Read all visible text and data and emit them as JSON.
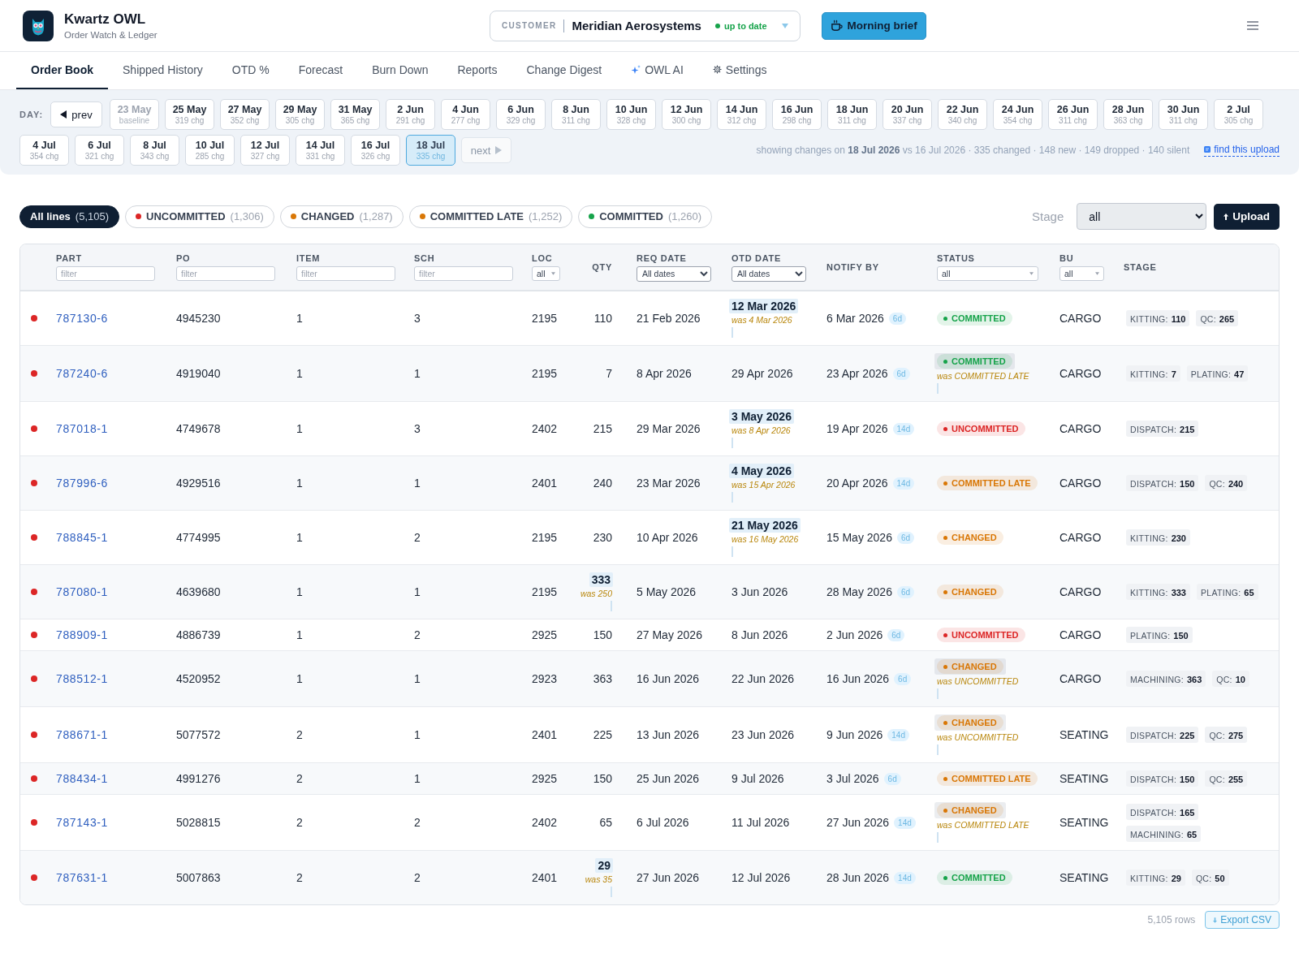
{
  "app": {
    "name": "Kwartz OWL",
    "tagline": "Order Watch & Ledger"
  },
  "customer": {
    "label": "CUSTOMER",
    "name": "Meridian Aerosystems",
    "sync": "up to date"
  },
  "brief_button": "Morning brief",
  "tabs": [
    {
      "label": "Order Book",
      "selected": true,
      "kind": "page"
    },
    {
      "label": "Shipped History",
      "selected": false,
      "kind": "page"
    },
    {
      "label": "OTD %",
      "selected": false,
      "kind": "page"
    },
    {
      "label": "Forecast",
      "selected": false,
      "kind": "page"
    },
    {
      "label": "Burn Down",
      "selected": false,
      "kind": "page"
    },
    {
      "label": "Reports",
      "selected": false,
      "kind": "page"
    },
    {
      "label": "Change Digest",
      "selected": false,
      "kind": "page"
    },
    {
      "label": "OWL AI",
      "selected": false,
      "kind": "assistant"
    },
    {
      "label": "Settings",
      "selected": false,
      "kind": "settings"
    }
  ],
  "day_picker": {
    "label": "DAY:",
    "prev": {
      "label": "prev",
      "disabled": false
    },
    "days": [
      {
        "date": "23 May",
        "note": "baseline",
        "selected": false,
        "disabled": true
      },
      {
        "date": "25 May",
        "note": "319 chg",
        "selected": false,
        "disabled": false
      },
      {
        "date": "27 May",
        "note": "352 chg",
        "selected": false,
        "disabled": false
      },
      {
        "date": "29 May",
        "note": "305 chg",
        "selected": false,
        "disabled": false
      },
      {
        "date": "31 May",
        "note": "365 chg",
        "selected": false,
        "disabled": false
      },
      {
        "date": "2 Jun",
        "note": "291 chg",
        "selected": false,
        "disabled": false
      },
      {
        "date": "4 Jun",
        "note": "277 chg",
        "selected": false,
        "disabled": false
      },
      {
        "date": "6 Jun",
        "note": "329 chg",
        "selected": false,
        "disabled": false
      },
      {
        "date": "8 Jun",
        "note": "311 chg",
        "selected": false,
        "disabled": false
      },
      {
        "date": "10 Jun",
        "note": "328 chg",
        "selected": false,
        "disabled": false
      },
      {
        "date": "12 Jun",
        "note": "300 chg",
        "selected": false,
        "disabled": false
      },
      {
        "date": "14 Jun",
        "note": "312 chg",
        "selected": false,
        "disabled": false
      },
      {
        "date": "16 Jun",
        "note": "298 chg",
        "selected": false,
        "disabled": false
      },
      {
        "date": "18 Jun",
        "note": "311 chg",
        "selected": false,
        "disabled": false
      },
      {
        "date": "20 Jun",
        "note": "337 chg",
        "selected": false,
        "disabled": false
      },
      {
        "date": "22 Jun",
        "note": "340 chg",
        "selected": false,
        "disabled": false
      },
      {
        "date": "24 Jun",
        "note": "354 chg",
        "selected": false,
        "disabled": false
      },
      {
        "date": "26 Jun",
        "note": "311 chg",
        "selected": false,
        "disabled": false
      },
      {
        "date": "28 Jun",
        "note": "363 chg",
        "selected": false,
        "disabled": false
      },
      {
        "date": "30 Jun",
        "note": "311 chg",
        "selected": false,
        "disabled": false
      },
      {
        "date": "2 Jul",
        "note": "305 chg",
        "selected": false,
        "disabled": false
      },
      {
        "date": "4 Jul",
        "note": "354 chg",
        "selected": false,
        "disabled": false
      },
      {
        "date": "6 Jul",
        "note": "321 chg",
        "selected": false,
        "disabled": false
      },
      {
        "date": "8 Jul",
        "note": "343 chg",
        "selected": false,
        "disabled": false
      },
      {
        "date": "10 Jul",
        "note": "285 chg",
        "selected": false,
        "disabled": false
      },
      {
        "date": "12 Jul",
        "note": "327 chg",
        "selected": false,
        "disabled": false
      },
      {
        "date": "14 Jul",
        "note": "331 chg",
        "selected": false,
        "disabled": false
      },
      {
        "date": "16 Jul",
        "note": "326 chg",
        "selected": false,
        "disabled": false
      },
      {
        "date": "18 Jul",
        "note": "335 chg",
        "selected": true,
        "disabled": false
      }
    ],
    "next": {
      "label": "next",
      "disabled": true
    },
    "summary": "showing changes on **18 Jul 2026** vs 16 Jul 2026 · 335 changed · 148 new · 149 dropped · 140 silent",
    "link": "find this upload"
  },
  "line_filters": [
    {
      "label": "All lines",
      "count": "(5,105)",
      "selected": true
    },
    {
      "label": "UNCOMMITTED",
      "count": "(1,306)",
      "selected": false,
      "color": "#dc2626"
    },
    {
      "label": "CHANGED",
      "count": "(1,287)",
      "selected": false,
      "color": "#d97706"
    },
    {
      "label": "COMMITTED LATE",
      "count": "(1,252)",
      "selected": false,
      "color": "#d97706"
    },
    {
      "label": "COMMITTED",
      "count": "(1,260)",
      "selected": false,
      "color": "#16a34a"
    }
  ],
  "stage_filter": {
    "label": "Stage",
    "value": "all"
  },
  "upload_button": "Upload",
  "table": {
    "columns": [
      {
        "label": "PART",
        "filter": {
          "kind": "input",
          "placeholder": "filter"
        }
      },
      {
        "label": "PO",
        "filter": {
          "kind": "input",
          "placeholder": "filter"
        }
      },
      {
        "label": "ITEM",
        "filter": {
          "kind": "input",
          "placeholder": "filter"
        }
      },
      {
        "label": "SCH",
        "filter": {
          "kind": "input",
          "placeholder": "filter"
        }
      },
      {
        "label": "LOC",
        "filter": {
          "kind": "picker",
          "value": "all"
        }
      },
      {
        "label": "QTY"
      },
      {
        "label": "REQ DATE",
        "filter": {
          "kind": "select",
          "value": "All dates"
        }
      },
      {
        "label": "OTD DATE",
        "filter": {
          "kind": "select",
          "value": "All dates"
        }
      },
      {
        "label": "NOTIFY BY"
      },
      {
        "label": "STATUS",
        "filter": {
          "kind": "picker",
          "value": "all"
        }
      },
      {
        "label": "BU",
        "filter": {
          "kind": "picker",
          "value": "all"
        }
      },
      {
        "label": "STAGE"
      }
    ],
    "rows": [
      {
        "flagged": true,
        "part": "787130-6",
        "po": "4945230",
        "item": "1",
        "sch": "3",
        "loc": "2195",
        "qty": {
          "value": "110"
        },
        "req_date": "21 Feb 2026",
        "otd_date": {
          "value": "12 Mar 2026",
          "was": "was 4 Mar 2026"
        },
        "notify_by": {
          "date": "6 Mar 2026",
          "lead": "6d"
        },
        "status": {
          "label": "COMMITTED",
          "color": "#16a34a"
        },
        "bu": "CARGO",
        "stages": [
          {
            "label": "KITTING:",
            "value": "110"
          },
          {
            "label": "QC:",
            "value": "265"
          }
        ]
      },
      {
        "flagged": true,
        "part": "787240-6",
        "po": "4919040",
        "item": "1",
        "sch": "1",
        "loc": "2195",
        "qty": {
          "value": "7"
        },
        "req_date": "8 Apr 2026",
        "otd_date": {
          "value": "29 Apr 2026"
        },
        "notify_by": {
          "date": "23 Apr 2026",
          "lead": "6d"
        },
        "status": {
          "label": "COMMITTED",
          "color": "#16a34a",
          "was": "was COMMITTED LATE"
        },
        "bu": "CARGO",
        "stages": [
          {
            "label": "KITTING:",
            "value": "7"
          },
          {
            "label": "PLATING:",
            "value": "47"
          }
        ]
      },
      {
        "flagged": true,
        "part": "787018-1",
        "po": "4749678",
        "item": "1",
        "sch": "3",
        "loc": "2402",
        "qty": {
          "value": "215"
        },
        "req_date": "29 Mar 2026",
        "otd_date": {
          "value": "3 May 2026",
          "was": "was 8 Apr 2026"
        },
        "notify_by": {
          "date": "19 Apr 2026",
          "lead": "14d"
        },
        "status": {
          "label": "UNCOMMITTED",
          "color": "#dc2626"
        },
        "bu": "CARGO",
        "stages": [
          {
            "label": "DISPATCH:",
            "value": "215"
          }
        ]
      },
      {
        "flagged": true,
        "part": "787996-6",
        "po": "4929516",
        "item": "1",
        "sch": "1",
        "loc": "2401",
        "qty": {
          "value": "240"
        },
        "req_date": "23 Mar 2026",
        "otd_date": {
          "value": "4 May 2026",
          "was": "was 15 Apr 2026"
        },
        "notify_by": {
          "date": "20 Apr 2026",
          "lead": "14d"
        },
        "status": {
          "label": "COMMITTED LATE",
          "color": "#d97706"
        },
        "bu": "CARGO",
        "stages": [
          {
            "label": "DISPATCH:",
            "value": "150"
          },
          {
            "label": "QC:",
            "value": "240"
          }
        ]
      },
      {
        "flagged": true,
        "part": "788845-1",
        "po": "4774995",
        "item": "1",
        "sch": "2",
        "loc": "2195",
        "qty": {
          "value": "230"
        },
        "req_date": "10 Apr 2026",
        "otd_date": {
          "value": "21 May 2026",
          "was": "was 16 May 2026"
        },
        "notify_by": {
          "date": "15 May 2026",
          "lead": "6d"
        },
        "status": {
          "label": "CHANGED",
          "color": "#d97706"
        },
        "bu": "CARGO",
        "stages": [
          {
            "label": "KITTING:",
            "value": "230"
          }
        ]
      },
      {
        "flagged": true,
        "part": "787080-1",
        "po": "4639680",
        "item": "1",
        "sch": "1",
        "loc": "2195",
        "qty": {
          "value": "333",
          "was": "was 250"
        },
        "req_date": "5 May 2026",
        "otd_date": {
          "value": "3 Jun 2026"
        },
        "notify_by": {
          "date": "28 May 2026",
          "lead": "6d"
        },
        "status": {
          "label": "CHANGED",
          "color": "#d97706"
        },
        "bu": "CARGO",
        "stages": [
          {
            "label": "KITTING:",
            "value": "333"
          },
          {
            "label": "PLATING:",
            "value": "65"
          }
        ]
      },
      {
        "flagged": true,
        "part": "788909-1",
        "po": "4886739",
        "item": "1",
        "sch": "2",
        "loc": "2925",
        "qty": {
          "value": "150"
        },
        "req_date": "27 May 2026",
        "otd_date": {
          "value": "8 Jun 2026"
        },
        "notify_by": {
          "date": "2 Jun 2026",
          "lead": "6d"
        },
        "status": {
          "label": "UNCOMMITTED",
          "color": "#dc2626"
        },
        "bu": "CARGO",
        "stages": [
          {
            "label": "PLATING:",
            "value": "150"
          }
        ]
      },
      {
        "flagged": true,
        "part": "788512-1",
        "po": "4520952",
        "item": "1",
        "sch": "1",
        "loc": "2923",
        "qty": {
          "value": "363"
        },
        "req_date": "16 Jun 2026",
        "otd_date": {
          "value": "22 Jun 2026"
        },
        "notify_by": {
          "date": "16 Jun 2026",
          "lead": "6d"
        },
        "status": {
          "label": "CHANGED",
          "color": "#d97706",
          "was": "was UNCOMMITTED"
        },
        "bu": "CARGO",
        "stages": [
          {
            "label": "MACHINING:",
            "value": "363"
          },
          {
            "label": "QC:",
            "value": "10"
          }
        ]
      },
      {
        "flagged": true,
        "part": "788671-1",
        "po": "5077572",
        "item": "2",
        "sch": "1",
        "loc": "2401",
        "qty": {
          "value": "225"
        },
        "req_date": "13 Jun 2026",
        "otd_date": {
          "value": "23 Jun 2026"
        },
        "notify_by": {
          "date": "9 Jun 2026",
          "lead": "14d"
        },
        "status": {
          "label": "CHANGED",
          "color": "#d97706",
          "was": "was UNCOMMITTED"
        },
        "bu": "SEATING",
        "stages": [
          {
            "label": "DISPATCH:",
            "value": "225"
          },
          {
            "label": "QC:",
            "value": "275"
          }
        ]
      },
      {
        "flagged": true,
        "part": "788434-1",
        "po": "4991276",
        "item": "2",
        "sch": "1",
        "loc": "2925",
        "qty": {
          "value": "150"
        },
        "req_date": "25 Jun 2026",
        "otd_date": {
          "value": "9 Jul 2026"
        },
        "notify_by": {
          "date": "3 Jul 2026",
          "lead": "6d"
        },
        "status": {
          "label": "COMMITTED LATE",
          "color": "#d97706"
        },
        "bu": "SEATING",
        "stages": [
          {
            "label": "DISPATCH:",
            "value": "150"
          },
          {
            "label": "QC:",
            "value": "255"
          }
        ]
      },
      {
        "flagged": true,
        "part": "787143-1",
        "po": "5028815",
        "item": "2",
        "sch": "2",
        "loc": "2402",
        "qty": {
          "value": "65"
        },
        "req_date": "6 Jul 2026",
        "otd_date": {
          "value": "11 Jul 2026"
        },
        "notify_by": {
          "date": "27 Jun 2026",
          "lead": "14d"
        },
        "status": {
          "label": "CHANGED",
          "color": "#d97706",
          "was": "was COMMITTED LATE"
        },
        "bu": "SEATING",
        "stages": [
          {
            "label": "DISPATCH:",
            "value": "165"
          },
          {
            "label": "MACHINING:",
            "value": "65"
          }
        ]
      },
      {
        "flagged": true,
        "part": "787631-1",
        "po": "5007863",
        "item": "2",
        "sch": "2",
        "loc": "2401",
        "qty": {
          "value": "29",
          "was": "was 35"
        },
        "req_date": "27 Jun 2026",
        "otd_date": {
          "value": "12 Jul 2026"
        },
        "notify_by": {
          "date": "28 Jun 2026",
          "lead": "14d"
        },
        "status": {
          "label": "COMMITTED",
          "color": "#16a34a"
        },
        "bu": "SEATING",
        "stages": [
          {
            "label": "KITTING:",
            "value": "29"
          },
          {
            "label": "QC:",
            "value": "50"
          }
        ]
      }
    ]
  },
  "footer": {
    "row_count": "5,105 rows",
    "export_button": "Export CSV"
  }
}
